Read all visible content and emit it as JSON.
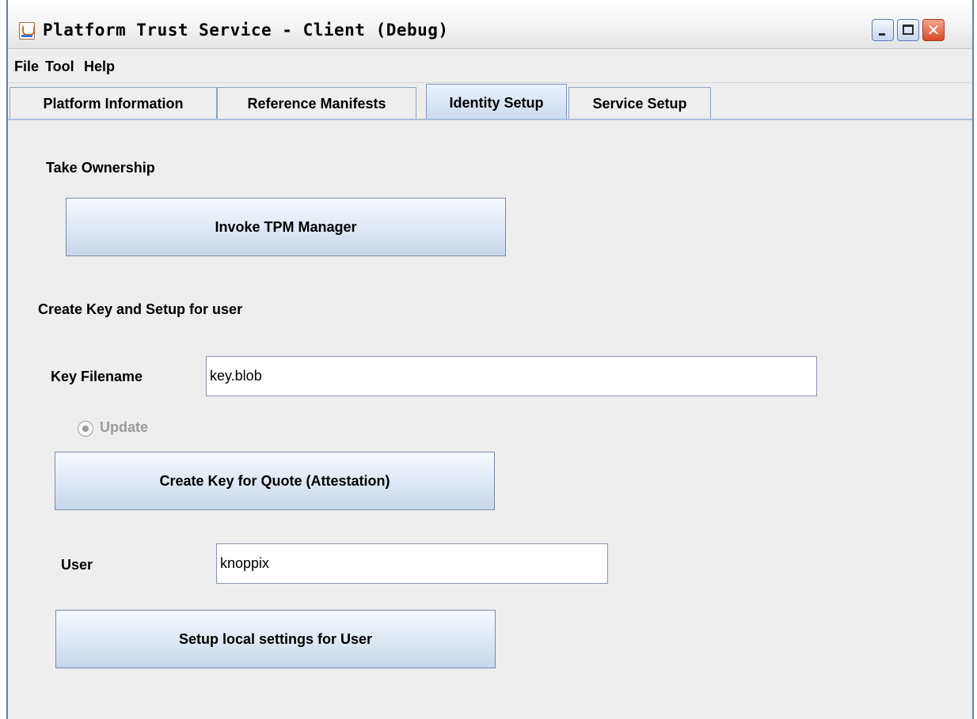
{
  "window": {
    "title": "Platform Trust Service - Client (Debug)"
  },
  "menu": [
    "File",
    "Tool",
    "Help"
  ],
  "tabs": [
    {
      "label": "Platform Information",
      "selected": false
    },
    {
      "label": "Reference Manifests",
      "selected": false
    },
    {
      "label": "Identity Setup",
      "selected": true
    },
    {
      "label": "Service Setup",
      "selected": false
    }
  ],
  "take_ownership": {
    "heading": "Take Ownership",
    "button_label": "Invoke TPM Manager"
  },
  "create_key": {
    "heading": "Create Key and Setup for user",
    "key_filename_label": "Key Filename",
    "key_filename_value": "key.blob",
    "update_label": "Update",
    "update_selected": true,
    "update_enabled": false,
    "create_button_label": "Create Key for Quote (Attestation)",
    "user_label": "User",
    "user_value": "knoppix",
    "setup_button_label": "Setup local settings for User"
  },
  "icons": {
    "app": "java-coffee-cup-icon",
    "minimize": "minimize-icon",
    "maximize": "maximize-icon",
    "close": "close-icon"
  },
  "colors": {
    "selected_tab": "#c9daf0",
    "button_gradient_bottom": "#c7d6ea",
    "close_button": "#d94a2a"
  }
}
